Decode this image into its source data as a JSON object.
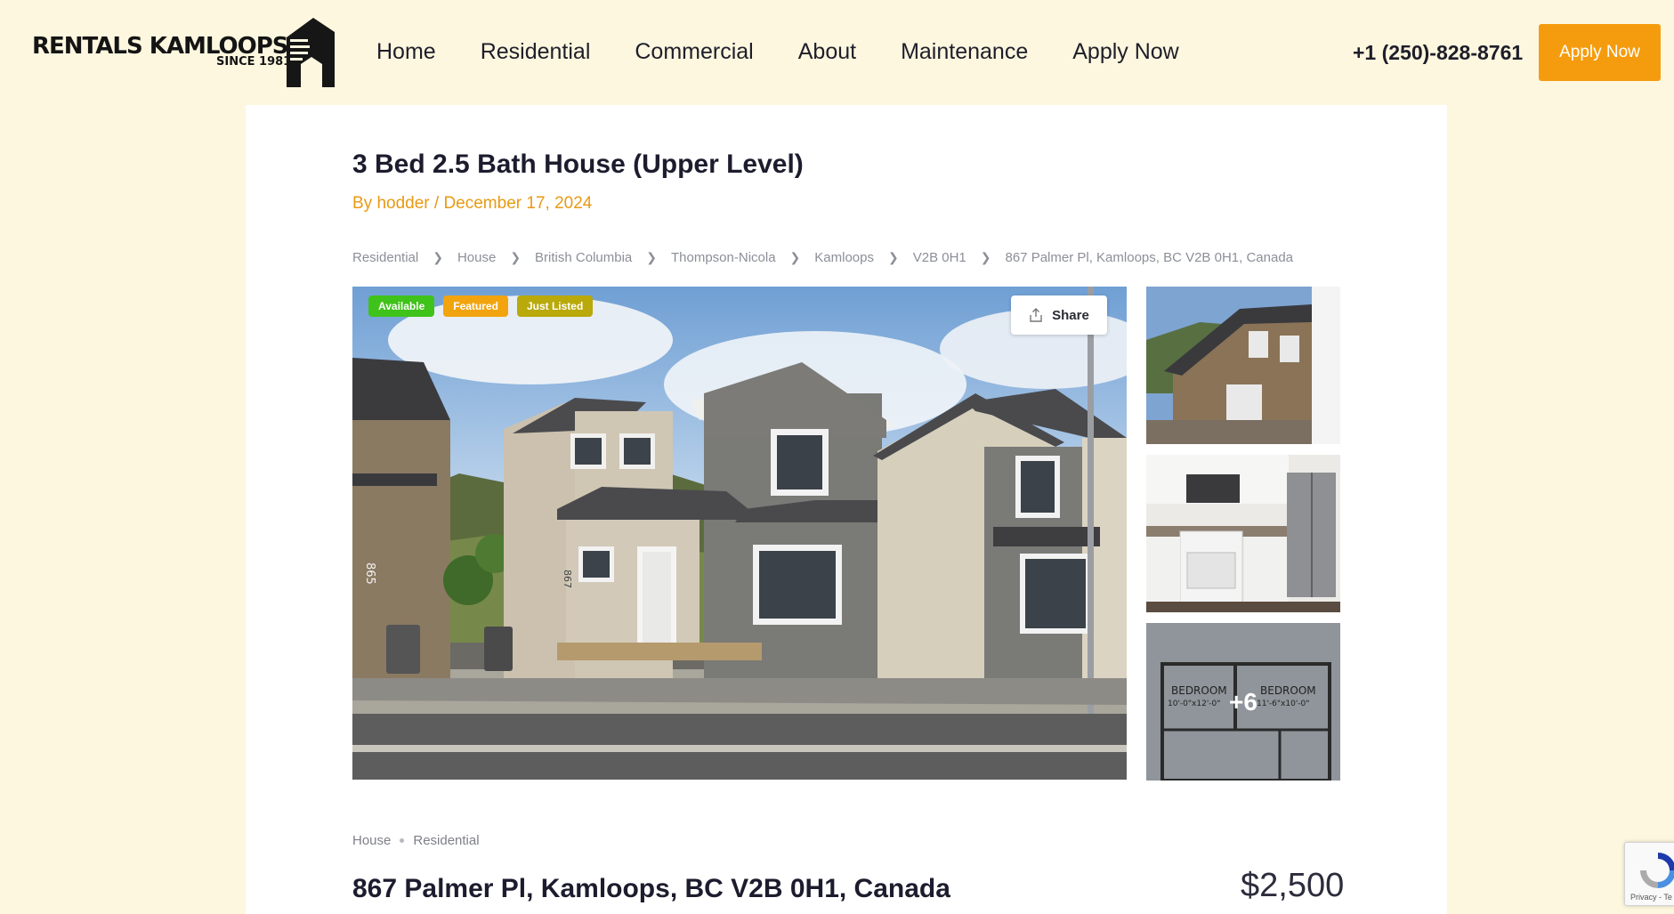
{
  "header": {
    "logo_main": "RENTALS KAMLOOPS",
    "logo_sub": "SINCE 1981",
    "nav": [
      "Home",
      "Residential",
      "Commercial",
      "About",
      "Maintenance",
      "Apply Now"
    ],
    "phone": "+1 (250)-828-8761",
    "apply_button": "Apply Now"
  },
  "listing": {
    "title": "3 Bed 2.5 Bath House (Upper Level)",
    "byline": "By hodder / December 17, 2024",
    "breadcrumbs": [
      "Residential",
      "House",
      "British Columbia",
      "Thompson-Nicola",
      "Kamloops",
      "V2B 0H1",
      "867 Palmer Pl, Kamloops, BC V2B 0H1, Canada"
    ],
    "badges": [
      {
        "label": "Available",
        "color": "#3fc21a"
      },
      {
        "label": "Featured",
        "color": "#f2a40f"
      },
      {
        "label": "Just Listed",
        "color": "#b9a90b"
      }
    ],
    "share_label": "Share",
    "more_photos": "+6",
    "types": [
      "House",
      "Residential"
    ],
    "address": "867 Palmer Pl, Kamloops, BC V2B 0H1, Canada",
    "price": "$2,500",
    "photo_numbers": {
      "left_house": "865",
      "main_house": "867"
    },
    "floorplan_labels": {
      "room1": "BEDROOM",
      "room1_size": "10'-0\"x12'-0\"",
      "room2": "BEDROOM",
      "room2_size": "11'-6\"x10'-0\""
    }
  },
  "recaptcha": {
    "text": "Privacy - Te"
  },
  "colors": {
    "accent": "#f59c0e",
    "page_bg": "#fdf7df",
    "byline": "#e89a14"
  }
}
